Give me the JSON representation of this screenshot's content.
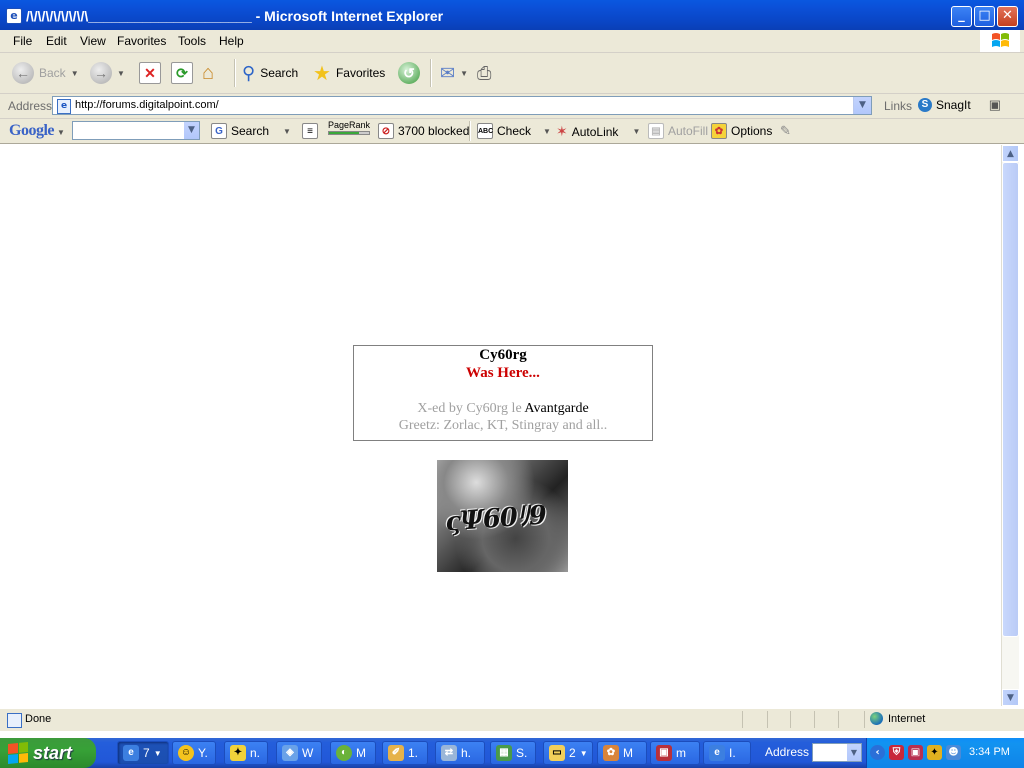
{
  "window": {
    "title": "/\\/\\/\\/\\/\\/\\/\\/\\_____________________ - Microsoft Internet Explorer",
    "minimize": "_",
    "maximize": "□",
    "close": "✕"
  },
  "menu": [
    "File",
    "Edit",
    "View",
    "Favorites",
    "Tools",
    "Help"
  ],
  "toolbar": {
    "back": "Back",
    "search": "Search",
    "favorites": "Favorites"
  },
  "address": {
    "label": "Address",
    "url": "http://forums.digitalpoint.com/",
    "links_label": "Links",
    "snagit": "SnagIt"
  },
  "google_toolbar": {
    "logo": "Google",
    "search_button": "Search",
    "pagerank_label": "PageRank",
    "pagerank_level": 0.75,
    "blocked": "3700 blocked",
    "check": "Check",
    "autolink": "AutoLink",
    "autofill": "AutoFill",
    "options": "Options"
  },
  "page": {
    "line1": "Cy60rg",
    "line2": "Was Here...",
    "line3_prefix": "X-ed by Cy60rg le ",
    "line3_name": "Avantgarde",
    "line4": "Greetz: Zorlac, KT, Stingray and all..",
    "image_text": "ςΨ60ﾘ9"
  },
  "status": {
    "text": "Done",
    "zone": "Internet"
  },
  "taskbar": {
    "start": "start",
    "items": [
      {
        "label": "7",
        "icon": "ie-icon",
        "active": true
      },
      {
        "label": "Y.",
        "icon": "yahoo-messenger-icon"
      },
      {
        "label": "n.",
        "icon": "aim-icon"
      },
      {
        "label": "W",
        "icon": "network-icon"
      },
      {
        "label": "M",
        "icon": "media-icon"
      },
      {
        "label": "1.",
        "icon": "tag-icon"
      },
      {
        "label": "h.",
        "icon": "network-share-icon"
      },
      {
        "label": "S.",
        "icon": "spreadsheet-icon"
      },
      {
        "label": "2",
        "icon": "folder-icon"
      },
      {
        "label": "M",
        "icon": "paint-icon"
      },
      {
        "label": "m",
        "icon": "app-icon"
      },
      {
        "label": "I.",
        "icon": "ie-window-icon"
      }
    ],
    "address_label": "Address",
    "clock": "3:34 PM"
  },
  "colors": {
    "accent_red": "#cc0000",
    "gray_text": "#a0a0a0",
    "xp_blue": "#245edb",
    "start_green": "#37a137"
  }
}
